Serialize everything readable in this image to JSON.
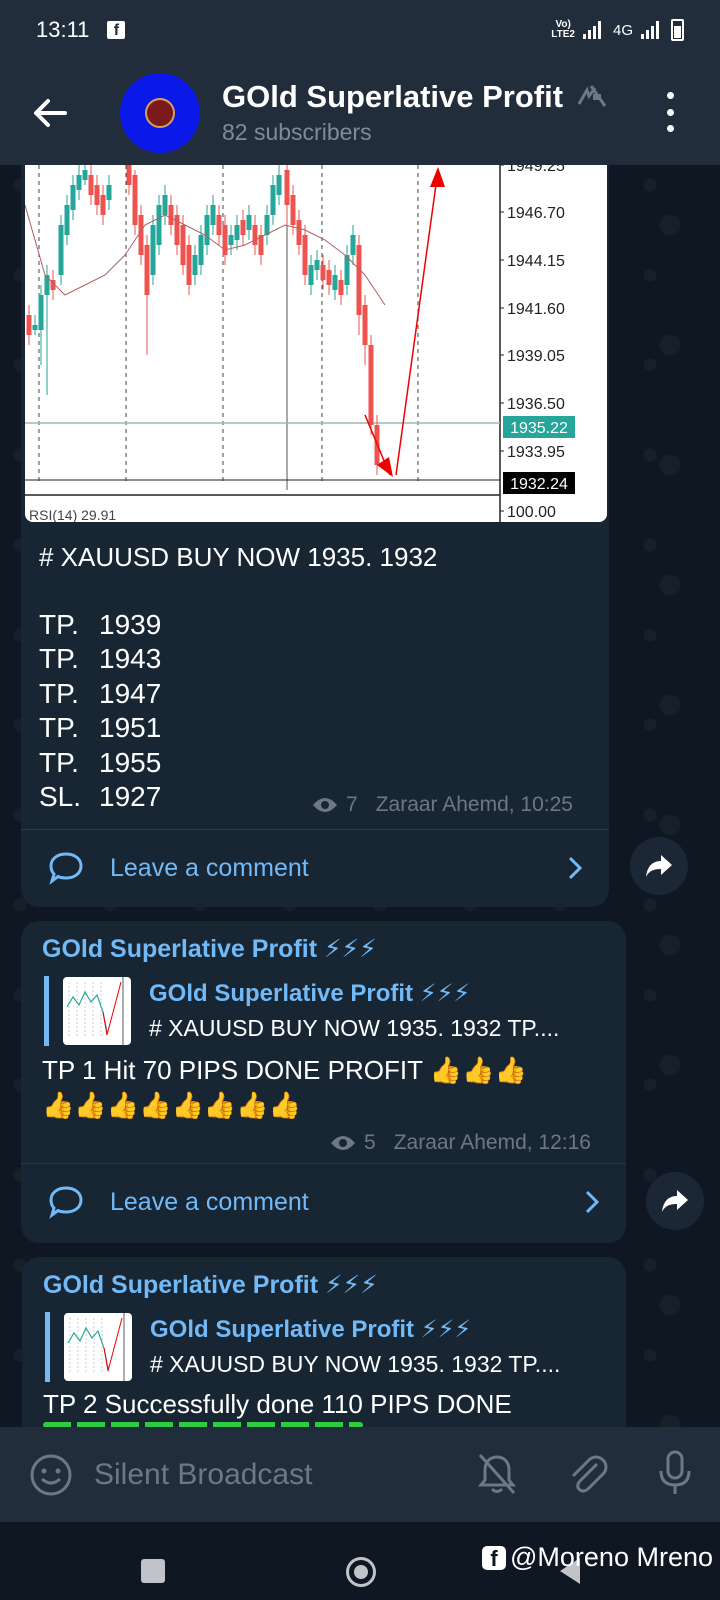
{
  "status_bar": {
    "time": "13:11",
    "network": "4G",
    "volte": "VoLTE2"
  },
  "header": {
    "title": "GOld Superlative Profit",
    "subscribers": "82 subscribers"
  },
  "post1": {
    "price_labels": [
      "1949.25",
      "1946.70",
      "1944.15",
      "1941.60",
      "1939.05",
      "1936.50",
      "1935.22",
      "1933.95",
      "1932.24",
      "100.00"
    ],
    "indicator_label": "RSI(14) 29.91",
    "headline": "# XAUUSD BUY NOW 1935. 1932",
    "targets": [
      {
        "label": "TP.",
        "value": "1939"
      },
      {
        "label": "TP.",
        "value": "1943"
      },
      {
        "label": "TP.",
        "value": "1947"
      },
      {
        "label": "TP.",
        "value": "1951"
      },
      {
        "label": "TP.",
        "value": "1955"
      },
      {
        "label": "SL.",
        "value": "1927"
      }
    ],
    "views": "7",
    "author_time": "Zaraar Ahemd, 10:25",
    "comment_label": "Leave a comment"
  },
  "post2": {
    "sender": "GOld Superlative Profit ⚡⚡⚡",
    "reply_name": "GOld Superlative Profit ⚡⚡⚡",
    "reply_text": "# XAUUSD BUY NOW 1935. 1932  TP....",
    "text_line1": "TP 1 Hit 70 PIPS DONE PROFIT 👍👍👍",
    "text_line2": "👍👍👍👍👍👍👍👍",
    "views": "5",
    "author_time": "Zaraar Ahemd, 12:16",
    "comment_label": "Leave a comment"
  },
  "post3": {
    "sender": "GOld Superlative Profit ⚡⚡⚡",
    "reply_name": "GOld Superlative Profit ⚡⚡⚡",
    "reply_text": "# XAUUSD BUY NOW 1935. 1932  TP....",
    "text_line1": "TP 2 Successfully done 110 PIPS DONE"
  },
  "input": {
    "placeholder": "Silent Broadcast"
  },
  "watermark": "@Moreno Mreno",
  "colors": {
    "accent": "#71baf7",
    "bubble": "#182533",
    "header": "#212d3b",
    "bull_candle": "#26a69a",
    "bear_candle": "#ef5350"
  }
}
